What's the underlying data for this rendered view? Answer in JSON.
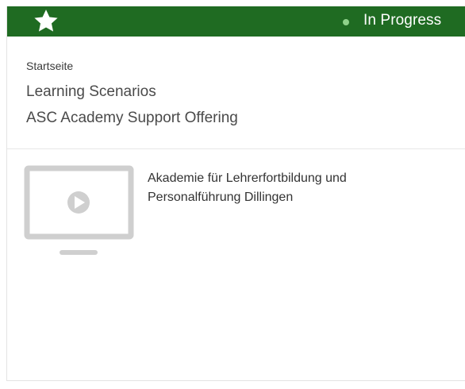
{
  "header": {
    "star_icon": "star-icon",
    "status_label": "In Progress",
    "status_color": "#8fd18a",
    "bar_color": "#1f6b22"
  },
  "breadcrumb": {
    "items": [
      "Startseite",
      "Learning Scenarios",
      "ASC Academy Support Offering"
    ]
  },
  "content": {
    "thumbnail_icon": "monitor-play-icon",
    "provider": "Akademie für Lehrerfortbildung und Personalführung Dillingen"
  }
}
